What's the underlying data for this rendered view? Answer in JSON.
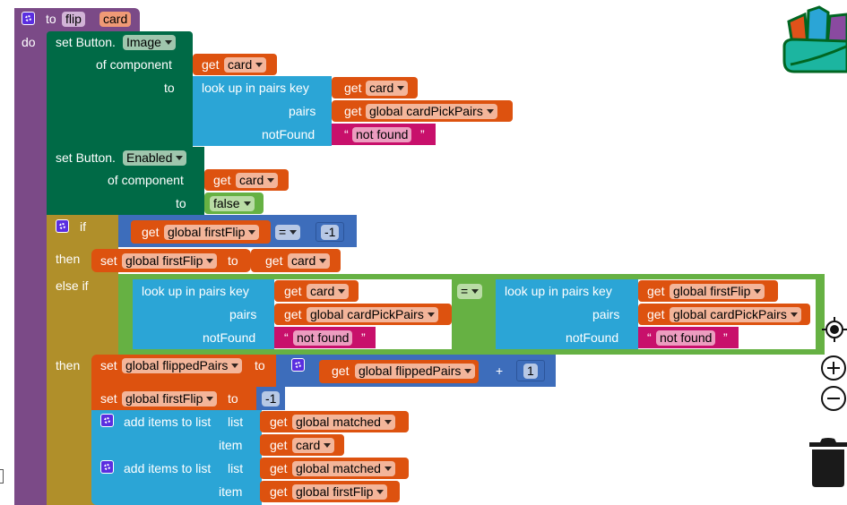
{
  "procedure": {
    "to_label": "to",
    "name": "flip",
    "param": "card",
    "do_label": "do"
  },
  "set_image": {
    "set_label": "set Button.",
    "property": "Image",
    "of_component_label": "of component",
    "to_label": "to",
    "component_get": "get",
    "component_var": "card",
    "lookup_label": "look up in pairs  key",
    "pairs_label": "pairs",
    "notfound_label": "notFound",
    "key_get": "get",
    "key_var": "card",
    "pairs_get": "get",
    "pairs_var": "global cardPickPairs",
    "notfound_open": "“",
    "notfound_text": "not found",
    "notfound_close": "”"
  },
  "set_enabled": {
    "set_label": "set Button.",
    "property": "Enabled",
    "of_component_label": "of component",
    "to_label": "to",
    "component_get": "get",
    "component_var": "card",
    "value": "false"
  },
  "if_block": {
    "if_label": "if",
    "then_label": "then",
    "elseif_label": "else if",
    "then2_label": "then",
    "cond_get": "get",
    "cond_var": "global firstFlip",
    "cond_op": "=",
    "cond_num": "-1",
    "then_set": "set",
    "then_var": "global firstFlip",
    "then_to": "to",
    "then_get": "get",
    "then_get_var": "card",
    "elseif_op": "=",
    "left_lookup": "look up in pairs  key",
    "left_pairs": "pairs",
    "left_notfound": "notFound",
    "left_key_get": "get",
    "left_key_var": "card",
    "left_pairs_get": "get",
    "left_pairs_var": "global cardPickPairs",
    "left_nf_text": "not found",
    "right_lookup": "look up in pairs  key",
    "right_pairs": "pairs",
    "right_notfound": "notFound",
    "right_key_get": "get",
    "right_key_var": "global firstFlip",
    "right_pairs_get": "get",
    "right_pairs_var": "global cardPickPairs",
    "right_nf_text": "not found",
    "quote_open": "“",
    "quote_close": "”"
  },
  "then2": {
    "set1": "set",
    "set1_var": "global flippedPairs",
    "set1_to": "to",
    "add_get": "get",
    "add_var": "global flippedPairs",
    "add_op": "+",
    "add_num": "1",
    "set2": "set",
    "set2_var": "global firstFlip",
    "set2_to": "to",
    "set2_num": "-1",
    "add1_label": "add items to list",
    "add1_list": "list",
    "add1_item": "item",
    "add1_list_get": "get",
    "add1_list_var": "global matched",
    "add1_item_get": "get",
    "add1_item_var": "card",
    "add2_label": "add items to list",
    "add2_list": "list",
    "add2_item": "item",
    "add2_list_get": "get",
    "add2_list_var": "global matched",
    "add2_item_get": "get",
    "add2_item_var": "global firstFlip"
  },
  "controls": {
    "backpack": "backpack-icon",
    "center": "recenter-icon",
    "zoom_in": "zoom-in-icon",
    "zoom_out": "zoom-out-icon",
    "trash": "trash-icon"
  }
}
